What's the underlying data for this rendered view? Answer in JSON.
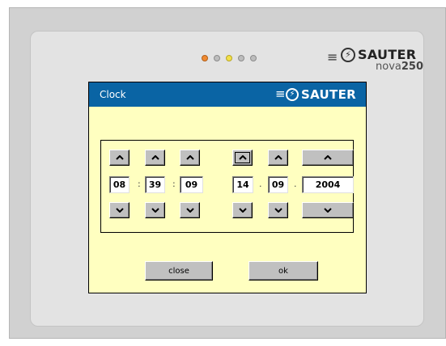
{
  "device": {
    "brand": "SAUTER",
    "model_prefix": "nova",
    "model_number": "250",
    "leds": [
      {
        "color": "orange"
      },
      {
        "color": "gray"
      },
      {
        "color": "yellow"
      },
      {
        "color": "gray"
      },
      {
        "color": "gray"
      }
    ]
  },
  "dialog": {
    "title": "Clock",
    "brand": "SAUTER"
  },
  "time": {
    "hours": "08",
    "minutes": "39",
    "seconds": "09",
    "separator": ":"
  },
  "date": {
    "day": "14",
    "month": "09",
    "year": "2004",
    "separator": "."
  },
  "actions": {
    "close_label": "close",
    "ok_label": "ok"
  },
  "icons": {
    "up": "chevron-up-icon",
    "down": "chevron-down-icon",
    "logo": "sauter-logo-icon"
  }
}
